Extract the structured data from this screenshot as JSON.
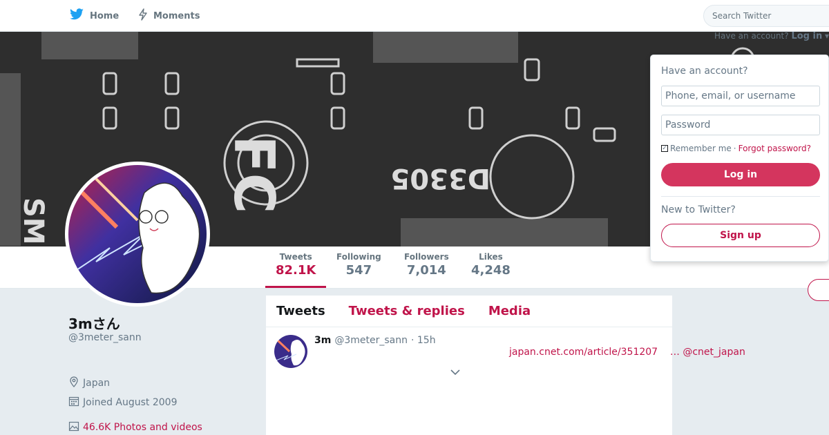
{
  "nav": {
    "home_label": "Home",
    "moments_label": "Moments",
    "search_placeholder": "Search Twitter"
  },
  "account_bar": {
    "prompt": "Have an account?",
    "login_label": "Log in"
  },
  "login_panel": {
    "title": "Have an account?",
    "username_placeholder": "Phone, email, or username",
    "password_placeholder": "Password",
    "remember_label": "Remember me",
    "separator": "·",
    "forgot_label": "Forgot password?",
    "login_button": "Log in",
    "new_prompt": "New to Twitter?",
    "signup_button": "Sign up"
  },
  "stats": [
    {
      "label": "Tweets",
      "value": "82.1K"
    },
    {
      "label": "Following",
      "value": "547"
    },
    {
      "label": "Followers",
      "value": "7,014"
    },
    {
      "label": "Likes",
      "value": "4,248"
    }
  ],
  "profile": {
    "name": "3mさん",
    "handle": "@3meter_sann",
    "location": "Japan",
    "joined": "Joined August 2009",
    "media": "46.6K Photos and videos"
  },
  "timeline": {
    "tabs": [
      "Tweets",
      "Tweets & replies",
      "Media"
    ],
    "tweet": {
      "name": "3m",
      "handle": "@3meter_sann",
      "time": "· 15h",
      "link": "japan.cnet.com/article/351207",
      "mention": "… @cnet_japan"
    }
  },
  "colors": {
    "accent": "#c0144a",
    "login_button": "#d4355e",
    "twitter_blue": "#1da1f2"
  }
}
